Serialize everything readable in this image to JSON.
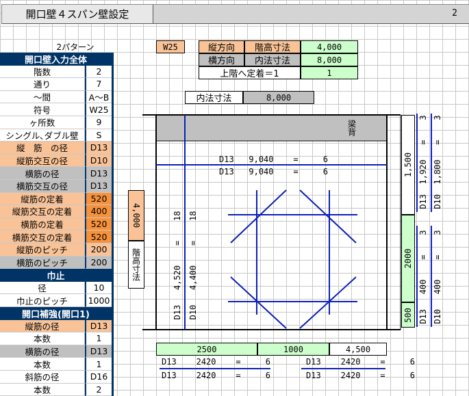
{
  "header": {
    "title": "開口壁４スパン壁設定",
    "page_number": "2"
  },
  "pattern_label": "2パターン",
  "top_info": {
    "code": "W25",
    "vertical_dir": "縦方向",
    "floor_height_label": "階高寸法",
    "floor_height_value": "4,000",
    "horizontal_dir": "横方向",
    "inner_dim_label": "内法寸法",
    "inner_dim_value": "8,000",
    "anchor_label": "上階へ定着＝1",
    "anchor_value": "1"
  },
  "inner_dim": {
    "label": "内法寸法",
    "value": "8,000"
  },
  "left_panel": {
    "section1": {
      "header": "開口壁入力全体",
      "rows": [
        {
          "label": "階数",
          "value": "2"
        },
        {
          "label": "通り",
          "value": "7"
        },
        {
          "label": "～間",
          "value": "A～B"
        },
        {
          "label": "符号",
          "value": "W25"
        },
        {
          "label": "ヶ所数",
          "value": "9"
        },
        {
          "label": "シングル､ダブル壁",
          "value": "S"
        },
        {
          "label": "縦　筋　の径",
          "value": "D13"
        },
        {
          "label": "縦筋交互の径",
          "value": "D10"
        },
        {
          "label": "横筋の径",
          "value": "D13"
        },
        {
          "label": "横筋交互の径",
          "value": "D13"
        },
        {
          "label": "縦筋の定着",
          "value": "520"
        },
        {
          "label": "縦筋交互の定着",
          "value": "400"
        },
        {
          "label": "横筋の定着",
          "value": "520"
        },
        {
          "label": "横筋交互の定着",
          "value": "520"
        },
        {
          "label": "縦筋のピッチ",
          "value": "200"
        },
        {
          "label": "横筋のピッチ",
          "value": "200"
        }
      ]
    },
    "section2": {
      "header": "巾止",
      "rows": [
        {
          "label": "径",
          "value": "10"
        },
        {
          "label": "巾止のピッチ",
          "value": "1000"
        }
      ]
    },
    "section3": {
      "header": "開口補強(開口1)",
      "rows": [
        {
          "label": "縦筋の径",
          "value": "D13"
        },
        {
          "label": "本数",
          "value": "1"
        },
        {
          "label": "横筋の径",
          "value": "D13"
        },
        {
          "label": "本数",
          "value": "1"
        },
        {
          "label": "斜筋の径",
          "value": "D16"
        },
        {
          "label": "本数",
          "value": "2"
        }
      ]
    }
  },
  "drawing": {
    "beam_label": "梁背",
    "floor_height_label": "階高寸法",
    "floor_height_value": "4,000",
    "horizontal_bars": [
      {
        "dia": "D13",
        "length": "9,040",
        "eq": "=",
        "count": "6"
      },
      {
        "dia": "D13",
        "length": "9,040",
        "eq": "=",
        "count": "6"
      }
    ],
    "vertical_bars": [
      {
        "dia": "D13",
        "length": "4,520",
        "eq": "=",
        "count": "18"
      },
      {
        "dia": "D10",
        "length": "4,400",
        "eq": "=",
        "count": "18"
      }
    ],
    "right_upper": {
      "dim": "1,500",
      "bars": [
        {
          "dia": "D13",
          "length": "1,920",
          "eq": "=",
          "count": "3"
        },
        {
          "dia": "D10",
          "length": "1,800",
          "eq": "=",
          "count": "3"
        }
      ]
    },
    "right_middle": {
      "dim": "2000",
      "bars": [
        {
          "dia": "D13",
          "length": "400",
          "eq": "=",
          "count": "3"
        },
        {
          "dia": "D10",
          "length": "400",
          "eq": "=",
          "count": "3"
        }
      ]
    },
    "right_bottom_dim": "500",
    "bottom_dims": {
      "left": "2500",
      "middle": "1000",
      "right": "4,500"
    },
    "bottom_bars_left": [
      {
        "dia": "D13",
        "length": "2420",
        "eq": "=",
        "count": "6"
      },
      {
        "dia": "D13",
        "length": "2420",
        "eq": "=",
        "count": "6"
      }
    ],
    "bottom_bars_right": [
      {
        "dia": "D13",
        "length": "2420",
        "eq": "=",
        "count": "6"
      },
      {
        "dia": "D13",
        "length": "2420",
        "eq": "=",
        "count": "6"
      }
    ]
  },
  "colors": {
    "orange": "#f9c397",
    "orange_dark": "#f7923a",
    "green": "#ccffcc",
    "gray": "#c0c0c0",
    "navy": "#003366",
    "blue_bar": "#0a1fb5",
    "highlight_blue": "#ccffff"
  }
}
